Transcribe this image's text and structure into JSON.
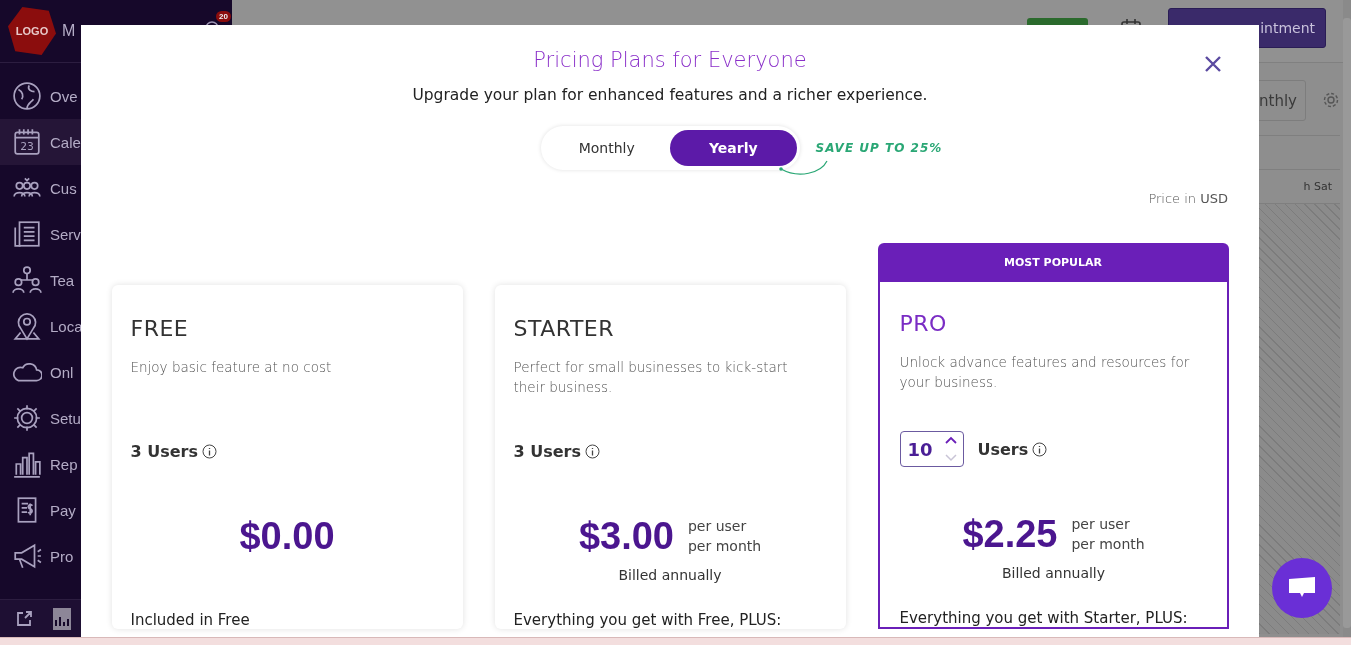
{
  "background": {
    "sidebar": {
      "logo": "LOGO",
      "account": "M",
      "notification_count": "20",
      "items": [
        {
          "label": "Ove",
          "selected": false
        },
        {
          "label": "Cale",
          "selected": true,
          "icon_text": "23"
        },
        {
          "label": "Cus",
          "selected": false
        },
        {
          "label": "Serv",
          "selected": false
        },
        {
          "label": "Tea",
          "selected": false
        },
        {
          "label": "Loca",
          "selected": false
        },
        {
          "label": "Onl",
          "selected": false
        },
        {
          "label": "Setu",
          "selected": false
        },
        {
          "label": "Rep",
          "selected": false
        },
        {
          "label": "Pay",
          "selected": false
        },
        {
          "label": "Pro",
          "selected": false
        }
      ]
    },
    "header": {
      "appointment_button": "intment"
    },
    "view_button": "nthly",
    "table_row": "h Sat"
  },
  "modal": {
    "title": "Pricing Plans for Everyone",
    "subtitle": "Upgrade your plan for enhanced features and a richer experience.",
    "billing_toggle": [
      {
        "label": "Monthly",
        "selected": false
      },
      {
        "label": "Yearly",
        "selected": true
      }
    ],
    "promo": "SAVE UP TO 25%",
    "currency_note": "Price in **USD**",
    "plans": [
      {
        "name": "FREE",
        "kind": "fixed",
        "popular": false,
        "description": "Enjoy basic feature at no cost",
        "users": "3 Users",
        "price": "$0.00",
        "features_heading": "Included in Free"
      },
      {
        "name": "STARTER",
        "kind": "fixed",
        "popular": false,
        "description": "Perfect for small businesses to kick-start their business.",
        "users": "3 Users",
        "price": "$3.00",
        "unit": [
          "per user",
          "per month"
        ],
        "billing": "Billed annually",
        "features_heading": "Everything you get with Free, PLUS:"
      },
      {
        "name": "PRO",
        "kind": "stepper",
        "popular": true,
        "badge": "MOST POPULAR",
        "description": "Unlock advance features and resources for your business.",
        "users_value": "10",
        "users": "Users",
        "price": "$2.25",
        "unit": [
          "per user",
          "per month"
        ],
        "billing": "Billed annually",
        "features_heading": "Everything you get with Starter, PLUS:"
      }
    ]
  }
}
